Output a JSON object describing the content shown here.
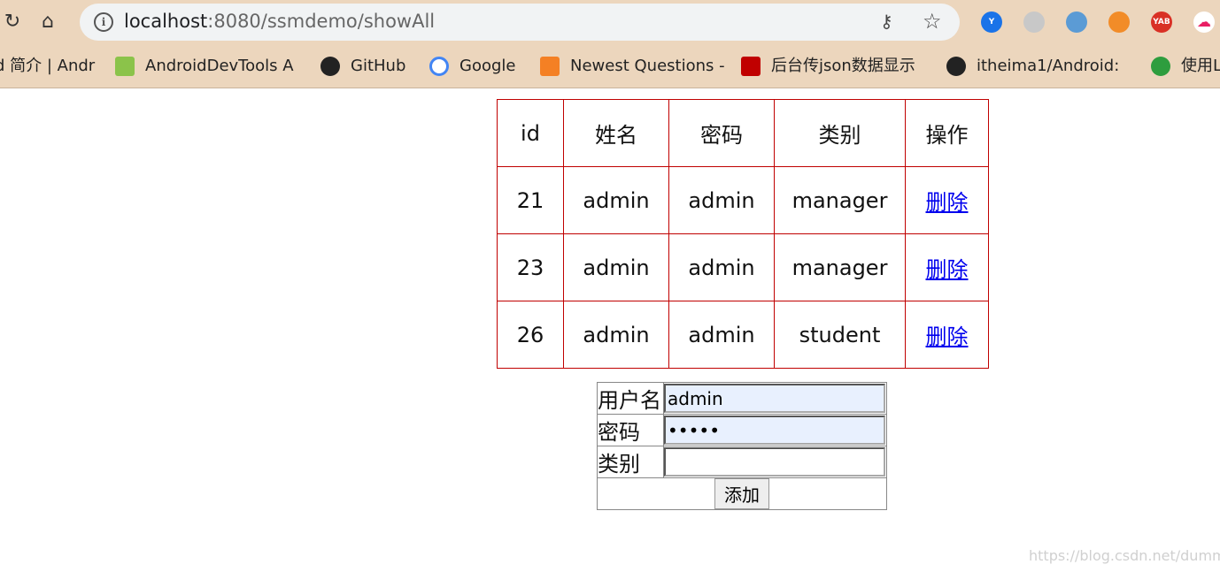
{
  "browser": {
    "url_host": "localhost",
    "url_rest": ":8080/ssmdemo/showAll",
    "extensions": [
      {
        "name": "yunzhi-ext",
        "color": "#1a73e8",
        "text": "Y"
      },
      {
        "name": "sitemap-ext",
        "color": "#c8c8c8",
        "text": ""
      },
      {
        "name": "browser-ext",
        "color": "#5b9bd5",
        "text": ""
      },
      {
        "name": "orange-ext",
        "color": "#f28c28",
        "text": ""
      },
      {
        "name": "yab-ext",
        "color": "#d93025",
        "text": "YAB"
      },
      {
        "name": "cloud-ext",
        "color": "#ffffff",
        "text": ""
      }
    ]
  },
  "bookmarks": [
    {
      "label": "d 简介 | Andr",
      "icon": "none"
    },
    {
      "label": "AndroidDevTools A",
      "icon": "android-devtools-icon",
      "color": "#8bc34a"
    },
    {
      "label": "GitHub",
      "icon": "github-icon",
      "color": "#222222"
    },
    {
      "label": "Google",
      "icon": "google-icon",
      "color": "#4285f4"
    },
    {
      "label": "Newest Questions -",
      "icon": "stackoverflow-icon",
      "color": "#f48024"
    },
    {
      "label": "后台传json数据显示",
      "icon": "csdn-icon",
      "color": "#c00000"
    },
    {
      "label": "itheima1/Android: ",
      "icon": "github-icon",
      "color": "#222222"
    },
    {
      "label": "使用L",
      "icon": "c-icon",
      "color": "#2e9d3e"
    }
  ],
  "table": {
    "headers": [
      "id",
      "姓名",
      "密码",
      "类别",
      "操作"
    ],
    "rows": [
      {
        "id": "21",
        "name": "admin",
        "password": "admin",
        "type": "manager",
        "action": "删除"
      },
      {
        "id": "23",
        "name": "admin",
        "password": "admin",
        "type": "manager",
        "action": "删除"
      },
      {
        "id": "26",
        "name": "admin",
        "password": "admin",
        "type": "student",
        "action": "删除"
      }
    ]
  },
  "form": {
    "username_label": "用户名",
    "username_value": "admin",
    "password_label": "密码",
    "password_value": "admin",
    "type_label": "类别",
    "type_value": "",
    "submit_label": "添加"
  },
  "watermark": "https://blog.csdn.net/dummyo"
}
